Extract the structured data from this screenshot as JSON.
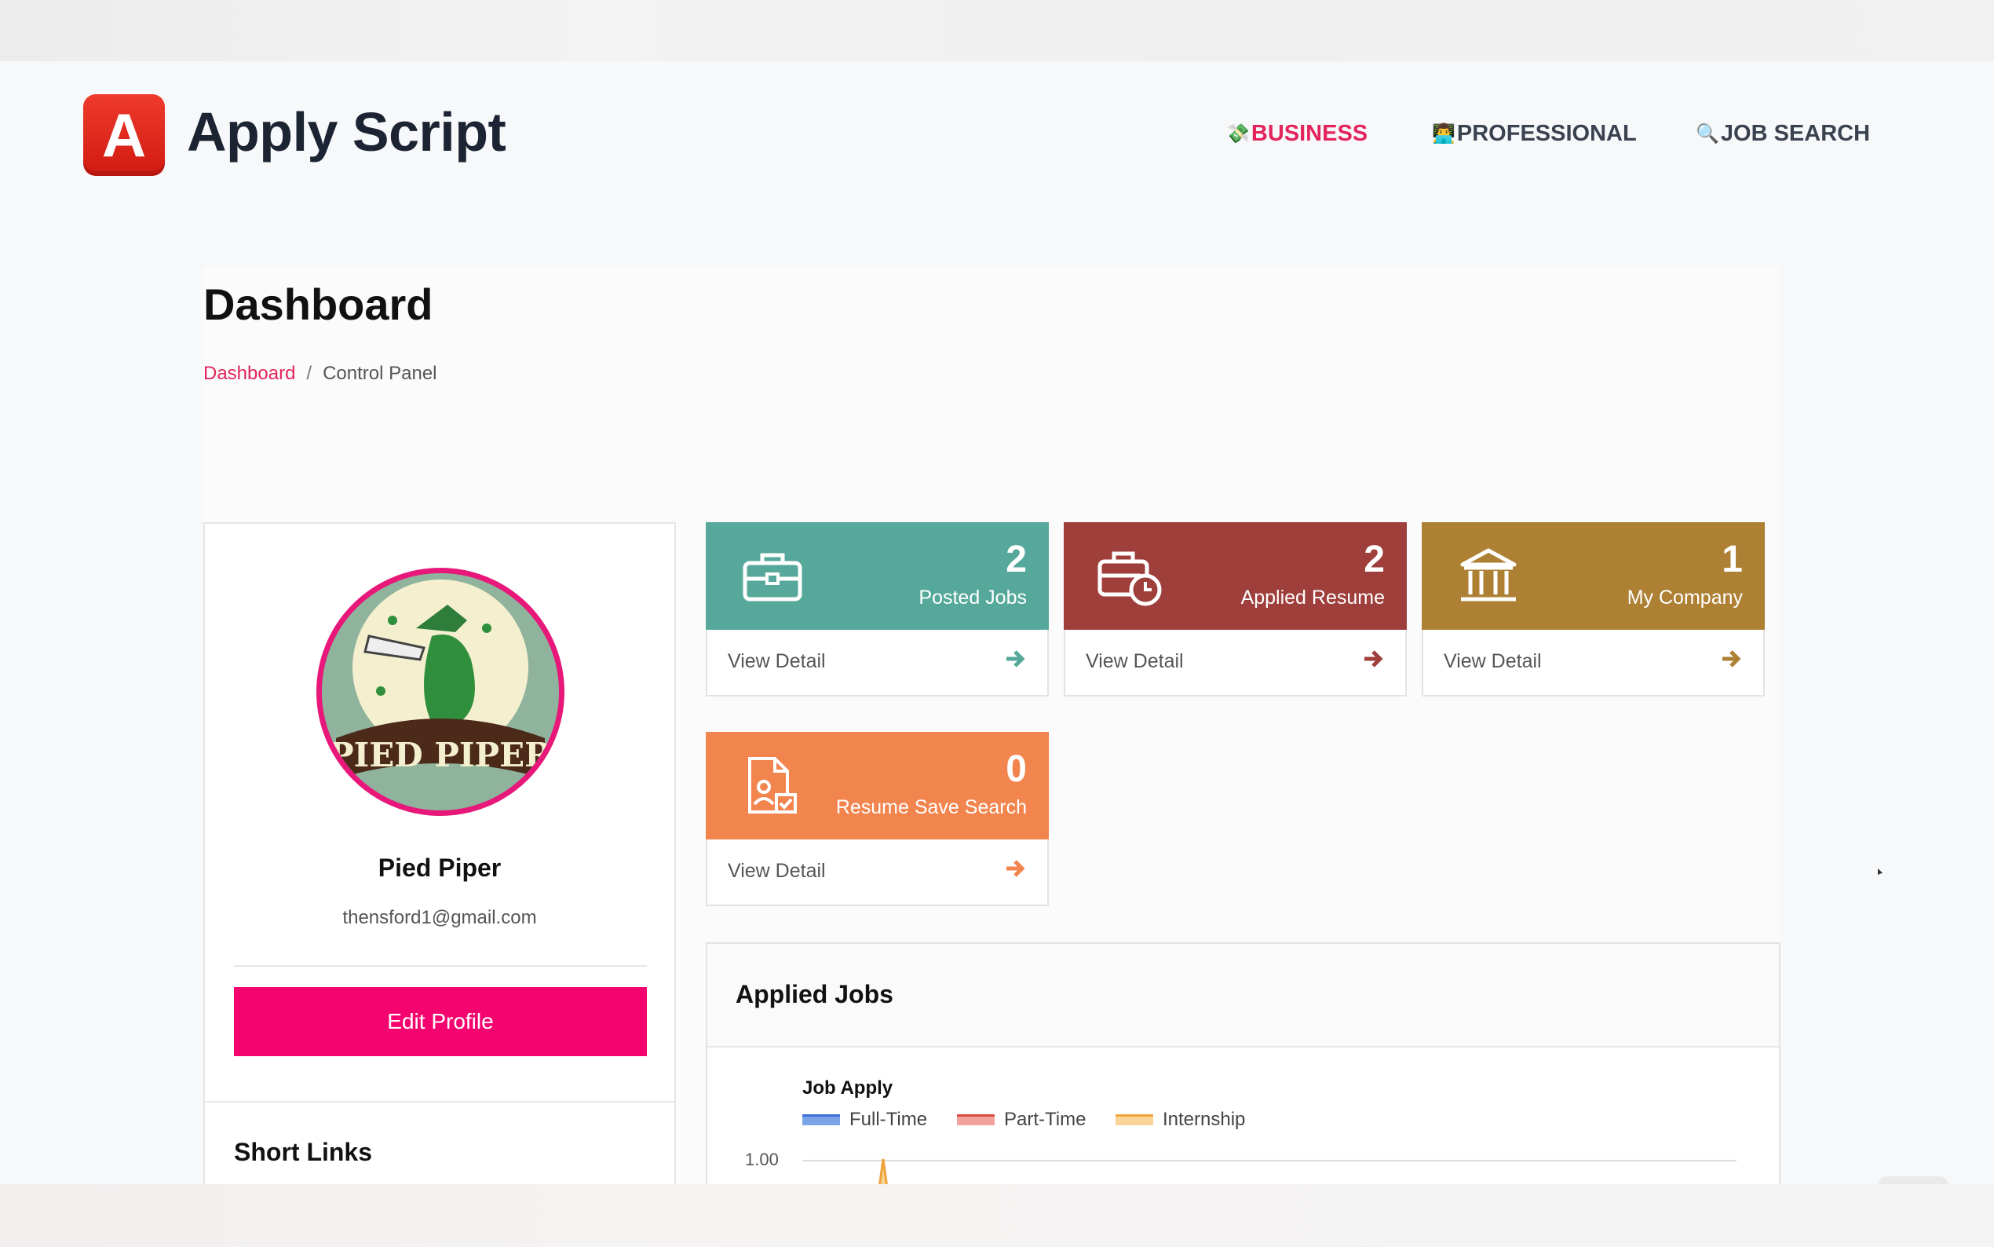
{
  "brand": {
    "logo_letter": "A",
    "name": "Apply Script",
    "logo_color": "#e02a1f"
  },
  "nav": {
    "items": [
      {
        "icon": "💸",
        "label": "BUSINESS",
        "active": true
      },
      {
        "icon": "👨‍💻",
        "label": "PROFESSIONAL",
        "active": false
      },
      {
        "icon": "🔍",
        "label": "JOB SEARCH",
        "active": false
      }
    ],
    "active_color": "#e3245c"
  },
  "page": {
    "title": "Dashboard",
    "breadcrumb": {
      "link": "Dashboard",
      "separator": "/",
      "current": "Control Panel"
    }
  },
  "profile": {
    "name": "Pied Piper",
    "email": "thensford1@gmail.com",
    "avatar_text": "PIED PIPER",
    "edit_label": "Edit Profile",
    "short_links_title": "Short Links"
  },
  "stats": [
    {
      "value": "2",
      "label": "Posted Jobs",
      "action": "View Detail",
      "color": "#56a99a",
      "icon": "briefcase-icon"
    },
    {
      "value": "2",
      "label": "Applied Resume",
      "action": "View Detail",
      "color": "#9f3f3b",
      "icon": "briefcase-clock-icon"
    },
    {
      "value": "1",
      "label": "My Company",
      "action": "View Detail",
      "color": "#ad8033",
      "icon": "bank-icon"
    },
    {
      "value": "0",
      "label": "Resume Save Search",
      "action": "View Detail",
      "color": "#f2844e",
      "icon": "resume-check-icon"
    }
  ],
  "applied_jobs": {
    "title": "Applied Jobs",
    "chart_data": {
      "type": "area",
      "title": "Job Apply",
      "series": [
        {
          "name": "Full-Time",
          "color": "#3b6fd6"
        },
        {
          "name": "Part-Time",
          "color": "#d94a3c"
        },
        {
          "name": "Internship",
          "color": "#f0a23a"
        }
      ],
      "y_ticks": [
        "1.00"
      ]
    }
  }
}
